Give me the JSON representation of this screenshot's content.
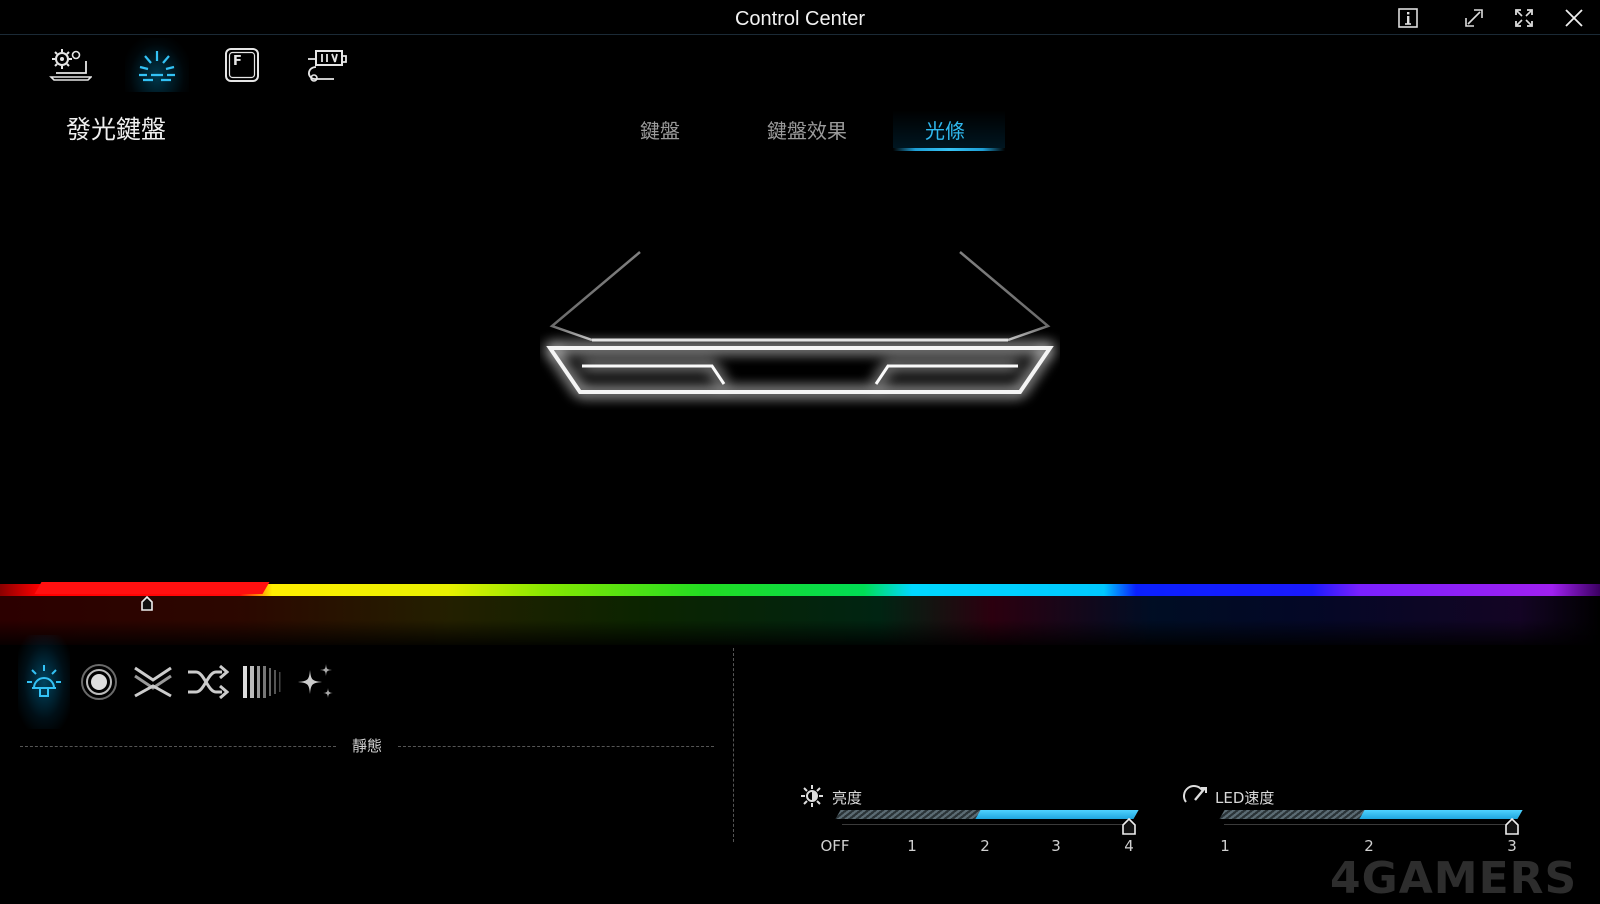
{
  "window": {
    "title": "Control Center",
    "buttons": [
      "info-icon",
      "restore-icon",
      "maximize-icon",
      "close-icon"
    ]
  },
  "nav": {
    "icons": [
      "settings-laptop-icon",
      "lighting-icon",
      "function-key-icon",
      "gaming-mouse-icon"
    ],
    "active": "lighting-icon"
  },
  "section_title": "發光鍵盤",
  "tabs": [
    {
      "label": "鍵盤"
    },
    {
      "label": "鍵盤效果"
    },
    {
      "label": "光條"
    }
  ],
  "active_tab": "光條",
  "colors": {
    "accent": "#2fb8ee",
    "selected_color": "#ff1010",
    "light_glow": "#ffffff"
  },
  "effects": {
    "icons": [
      "static-icon",
      "breathing-icon",
      "wave-icon",
      "random-icon",
      "spectrum-icon",
      "sparkle-icon"
    ],
    "selected": "static-icon",
    "selected_label": "靜態"
  },
  "brightness": {
    "label": "亮度",
    "ticks": [
      "OFF",
      "1",
      "2",
      "3",
      "4"
    ],
    "value": 4
  },
  "speed": {
    "label": "LED速度",
    "ticks": [
      "1",
      "2",
      "3"
    ],
    "value": 3
  },
  "watermark": "4GAMERS"
}
